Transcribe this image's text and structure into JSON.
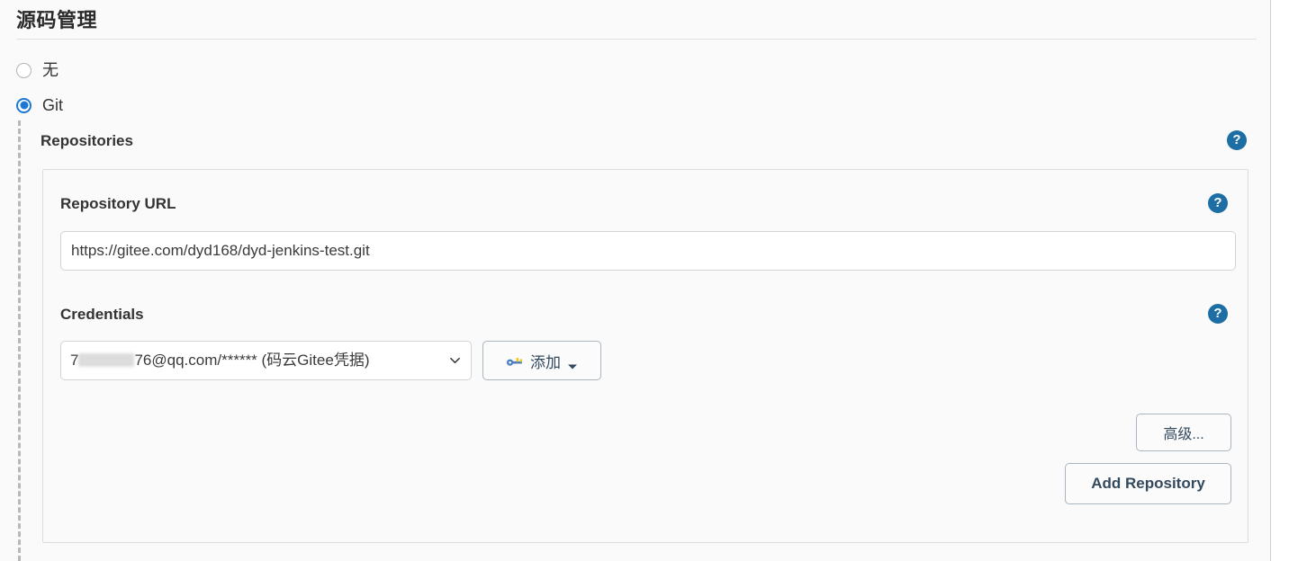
{
  "section": {
    "title": "源码管理"
  },
  "scm_options": [
    {
      "label": "无",
      "value": "none",
      "selected": false,
      "name": "scm-radio-none"
    },
    {
      "label": "Git",
      "value": "git",
      "selected": true,
      "name": "scm-radio-git"
    }
  ],
  "repositories": {
    "heading": "Repositories",
    "help_label": "?",
    "repository_url": {
      "label": "Repository URL",
      "value": "https://gitee.com/dyd168/dyd-jenkins-test.git",
      "placeholder": "",
      "help_label": "?"
    },
    "credentials": {
      "label": "Credentials",
      "selected_prefix": "7",
      "selected_suffix": "76@qq.com/****** (码云Gitee凭据)",
      "redacted": true,
      "help_label": "?",
      "add_button": {
        "label": "添加",
        "icon": "key-icon",
        "caret": "chevron-down-icon"
      }
    },
    "advanced_button": "高级...",
    "add_repository_button": "Add Repository"
  },
  "colors": {
    "accent_blue": "#1d78d3",
    "help_blue": "#1c6ea4",
    "button_text": "#33495e",
    "border_gray": "#d4d4d4",
    "page_bg": "#fafafa"
  }
}
